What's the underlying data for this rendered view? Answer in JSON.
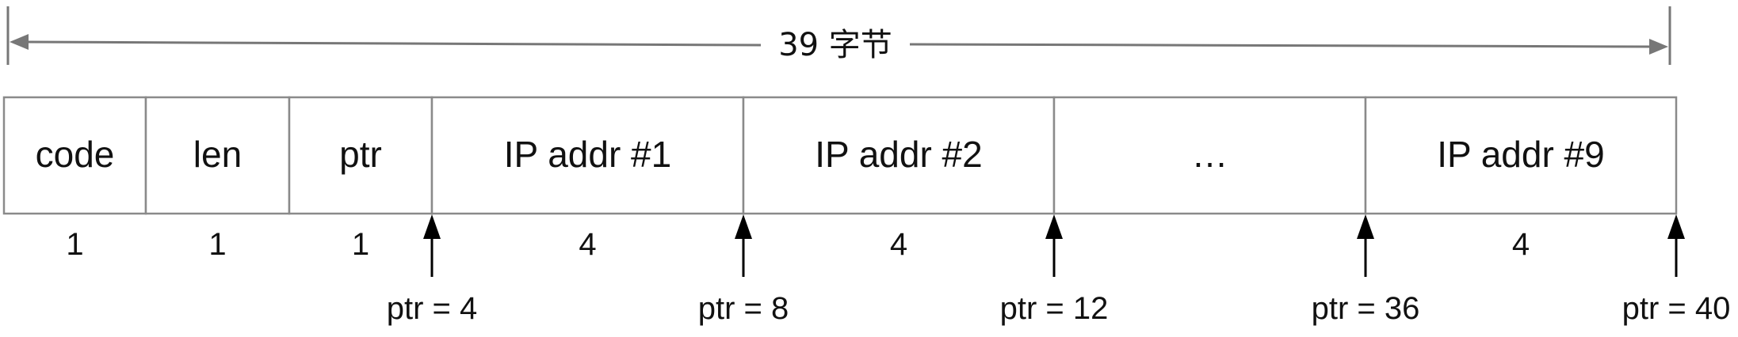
{
  "total_label": "39 字节",
  "fields": [
    {
      "label": "code",
      "size": "1"
    },
    {
      "label": "len",
      "size": "1"
    },
    {
      "label": "ptr",
      "size": "1"
    },
    {
      "label": "IP addr #1",
      "size": "4"
    },
    {
      "label": "IP addr #2",
      "size": "4"
    },
    {
      "label": "…",
      "size": ""
    },
    {
      "label": "IP addr #9",
      "size": "4"
    }
  ],
  "pointers": [
    "ptr = 4",
    "ptr = 8",
    "ptr = 12",
    "ptr = 36",
    "ptr = 40"
  ],
  "colors": {
    "border": "#8a8a8a",
    "text": "#111111",
    "arrow": "#000000",
    "span_line": "#777777"
  }
}
